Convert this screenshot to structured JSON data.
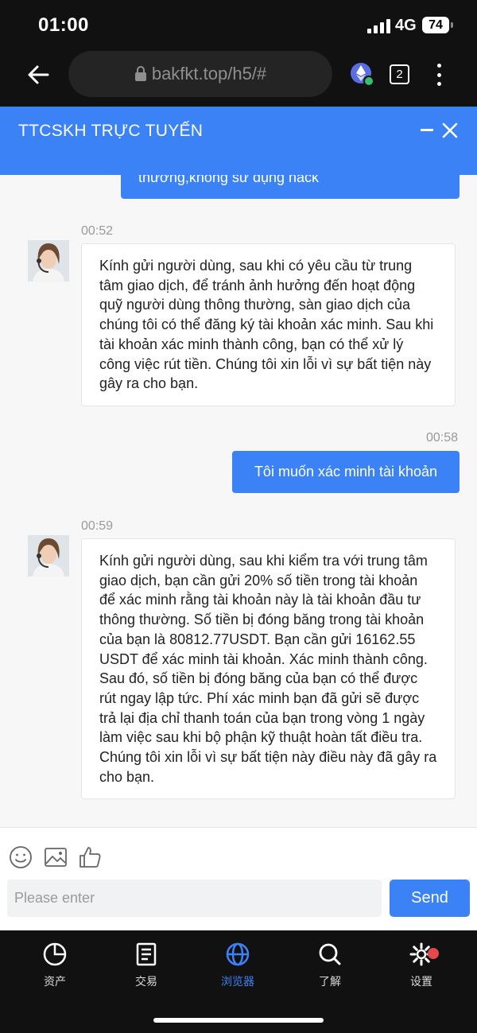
{
  "status_bar": {
    "time": "01:00",
    "network": "4G",
    "battery": "74"
  },
  "browser": {
    "url": "bakfkt.top/h5/#",
    "tab_count": "2"
  },
  "chat": {
    "title": "TTCSKH TRỰC TUYẾN",
    "partial_message": "thường,không sử dụng hack",
    "messages": [
      {
        "time": "00:52",
        "side": "left",
        "text": "Kính gửi người dùng, sau khi có yêu cầu từ trung tâm giao dịch, để tránh ảnh hưởng đến hoạt động quỹ người dùng thông thường, sàn giao dịch của chúng tôi có thể đăng ký tài khoản xác minh. Sau khi tài khoản xác minh thành công, bạn có thể xử lý công việc rút tiền. Chúng tôi xin lỗi vì sự bất tiện này gây ra cho bạn."
      },
      {
        "time": "00:58",
        "side": "right",
        "text": "Tôi muốn xác minh tài khoản"
      },
      {
        "time": "00:59",
        "side": "left",
        "text": "Kính gửi người dùng, sau khi kiểm tra với trung tâm giao dịch, bạn cần gửi 20% số tiền trong tài khoản để xác minh rằng tài khoản này là tài khoản đầu tư thông thường. Số tiền bị đóng băng trong tài khoản của bạn là 80812.77USDT. Bạn cần gửi 16162.55 USDT để xác minh tài khoản. Xác minh thành công. Sau đó, số tiền bị đóng băng của bạn có thể được rút ngay lập tức. Phí xác minh bạn đã gửi sẽ được trả lại địa chỉ thanh toán của bạn trong vòng 1 ngày làm việc sau khi bộ phận kỹ thuật hoàn tất điều tra. Chúng tôi xin lỗi vì sự bất tiện này điều này đã gây ra cho bạn."
      }
    ],
    "input_placeholder": "Please enter",
    "send_label": "Send"
  },
  "nav": {
    "items": [
      {
        "label": "资产",
        "icon": "pie-chart-icon"
      },
      {
        "label": "交易",
        "icon": "document-icon"
      },
      {
        "label": "浏览器",
        "icon": "globe-icon",
        "active": true
      },
      {
        "label": "了解",
        "icon": "search-icon"
      },
      {
        "label": "设置",
        "icon": "gear-icon"
      }
    ]
  },
  "colors": {
    "accent": "#3b82f6",
    "dark": "#111111",
    "badge": "#e5484d"
  }
}
